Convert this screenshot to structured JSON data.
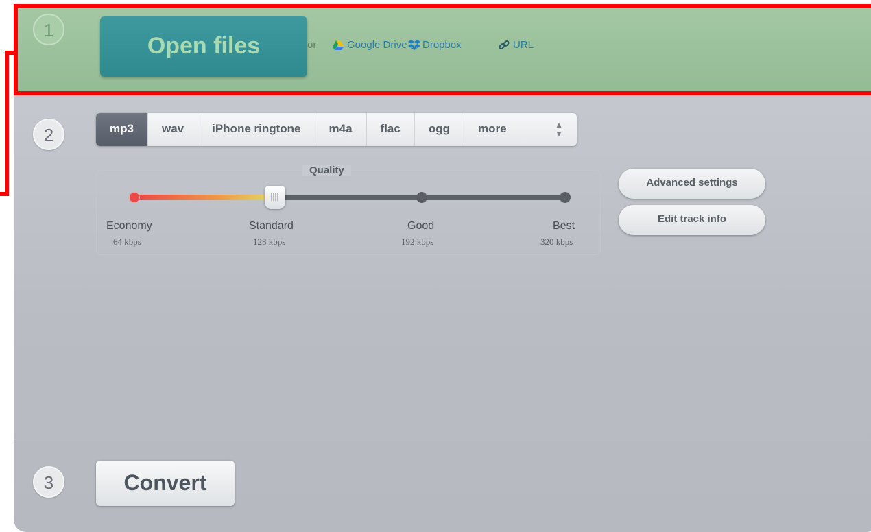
{
  "steps": {
    "one": "1",
    "two": "2",
    "three": "3"
  },
  "open": {
    "label": "Open files",
    "or": "or"
  },
  "sources": [
    {
      "label": "Google Drive",
      "icon": "google-drive-icon"
    },
    {
      "label": "Dropbox",
      "icon": "dropbox-icon"
    },
    {
      "label": "URL",
      "icon": "link-icon"
    }
  ],
  "formats": {
    "selected": "mp3",
    "tabs": [
      "mp3",
      "wav",
      "iPhone ringtone",
      "m4a",
      "flac",
      "ogg",
      "more"
    ]
  },
  "quality": {
    "title": "Quality",
    "selected_level": "Standard",
    "levels": [
      {
        "name": "Economy",
        "rate": "64 kbps"
      },
      {
        "name": "Standard",
        "rate": "128 kbps"
      },
      {
        "name": "Good",
        "rate": "192 kbps"
      },
      {
        "name": "Best",
        "rate": "320 kbps"
      }
    ]
  },
  "side_buttons": {
    "advanced": "Advanced settings",
    "edit": "Edit track info"
  },
  "convert": {
    "label": "Convert"
  },
  "colors": {
    "step1_bg": "#93bb94",
    "open_button": "#3f9aa0",
    "highlight": "#ff0000"
  }
}
